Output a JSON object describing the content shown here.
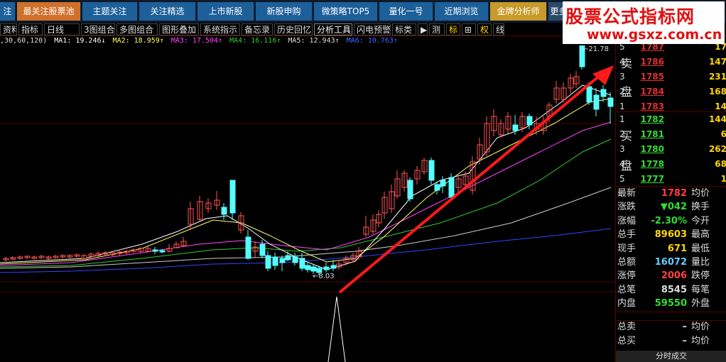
{
  "topbar": {
    "tabs": [
      "注",
      "最关注股票池",
      "主题关注",
      "关注精选",
      "上市新股",
      "新股申购",
      "微策略TOP5",
      "量化一号",
      "近期浏览",
      "金牌分析师",
      "更多"
    ]
  },
  "watermark": {
    "title": "股票公式指标网",
    "url": "www.gsxz.com.cn"
  },
  "toolbar": {
    "buttons": [
      "资料",
      "指标",
      "日线",
      "3图组合",
      "多图组合",
      "图形叠加",
      "系统指示",
      "备忘录",
      "历史回忆",
      "分析工具",
      "闪电预警",
      "标类",
      "▶",
      "测",
      "标",
      "⊞",
      "权",
      "线"
    ]
  },
  "ma_line": {
    "params": ",30,60,120)",
    "ma1": "MA1: 19.246↓",
    "ma2": "MA2: 18.959↑",
    "ma3": "MA3: 17.504↑",
    "ma4": "MA4: 16.116↑",
    "ma5": "MA5: 12.943↑",
    "ma6": "MA6: 10.763↑"
  },
  "chart": {
    "high_label": "21.78",
    "low_label": "8.03",
    "colors": {
      "up": "#ff5555",
      "down": "#54ffff",
      "ma1": "#ffffff",
      "ma2": "#ffff66",
      "ma3": "#ff44ff",
      "ma4": "#33cc33",
      "ma5": "#cccccc",
      "ma6": "#3344ff",
      "arrow": "#ff1a1a"
    }
  },
  "order_book": {
    "sell_label": [
      "卖",
      "盘"
    ],
    "buy_label": [
      "买",
      "盘"
    ],
    "sell": [
      {
        "level": "5",
        "price": "1787",
        "vol": "17"
      },
      {
        "level": "4",
        "price": "1786",
        "vol": "147"
      },
      {
        "level": "3",
        "price": "1785",
        "vol": "231"
      },
      {
        "level": "2",
        "price": "1784",
        "vol": "168"
      },
      {
        "level": "1",
        "price": "1783",
        "vol": "14"
      }
    ],
    "buy": [
      {
        "level": "1",
        "price": "1782",
        "vol": "144"
      },
      {
        "level": "2",
        "price": "1781",
        "vol": "6"
      },
      {
        "level": "3",
        "price": "1780",
        "vol": "262"
      },
      {
        "level": "4",
        "price": "1778",
        "vol": "68"
      },
      {
        "level": "5",
        "price": "1777",
        "vol": "1"
      }
    ]
  },
  "quote": [
    {
      "k": "最新",
      "v": "1782",
      "c": "#ff4040",
      "k2": "均价"
    },
    {
      "k": "涨跌",
      "v": "▼042",
      "c": "#33dd33",
      "k2": "换手"
    },
    {
      "k": "涨幅",
      "v": "-2.30%",
      "c": "#33dd33",
      "k2": "今开"
    },
    {
      "k": "总手",
      "v": "89603",
      "c": "#ffd700",
      "k2": "最高"
    },
    {
      "k": "现手",
      "v": "671",
      "c": "#ffd700",
      "k2": "最低"
    },
    {
      "k": "总额",
      "v": "16072",
      "c": "#66ccff",
      "k2": "量比"
    },
    {
      "k": "涨停",
      "v": "2006",
      "c": "#ff4040",
      "k2": "跌停"
    },
    {
      "k": "总笔",
      "v": "8545",
      "c": "#dddddd",
      "k2": "每笔"
    },
    {
      "k": "内盘",
      "v": "59550",
      "c": "#33dd33",
      "k2": "外盘"
    }
  ],
  "bottom_quote": [
    {
      "k": "总卖",
      "v": "–",
      "k2": "均价"
    },
    {
      "k": "总买",
      "v": "–",
      "k2": "均价"
    }
  ],
  "footer_label": "分时成交"
}
